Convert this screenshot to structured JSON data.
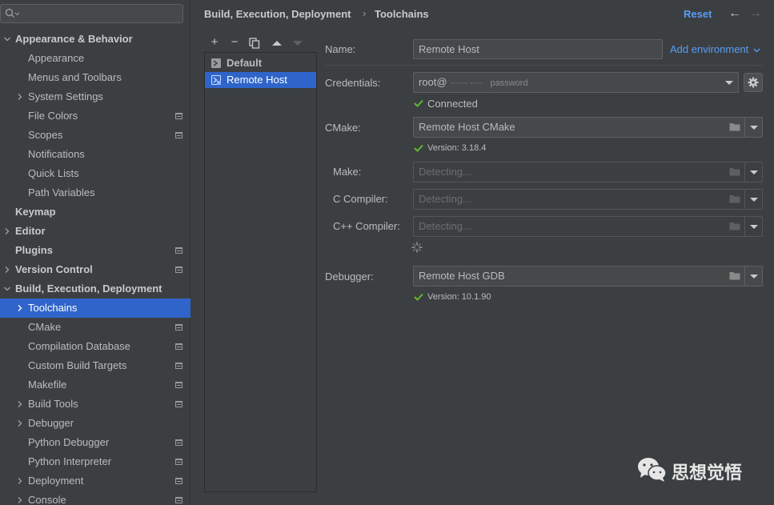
{
  "sidebar": {
    "search": {
      "placeholder": ""
    },
    "items": [
      {
        "label": "Appearance & Behavior",
        "indent": 0,
        "expanded": true,
        "bold": true
      },
      {
        "label": "Appearance",
        "indent": 1
      },
      {
        "label": "Menus and Toolbars",
        "indent": 1
      },
      {
        "label": "System Settings",
        "indent": 1,
        "collapsed": true
      },
      {
        "label": "File Colors",
        "indent": 1,
        "project": true
      },
      {
        "label": "Scopes",
        "indent": 1,
        "project": true
      },
      {
        "label": "Notifications",
        "indent": 1
      },
      {
        "label": "Quick Lists",
        "indent": 1
      },
      {
        "label": "Path Variables",
        "indent": 1
      },
      {
        "label": "Keymap",
        "indent": 0,
        "bold": true
      },
      {
        "label": "Editor",
        "indent": 0,
        "bold": true,
        "collapsed": true
      },
      {
        "label": "Plugins",
        "indent": 0,
        "bold": true,
        "project": true
      },
      {
        "label": "Version Control",
        "indent": 0,
        "bold": true,
        "collapsed": true,
        "project": true
      },
      {
        "label": "Build, Execution, Deployment",
        "indent": 0,
        "bold": true,
        "expanded": true
      },
      {
        "label": "Toolchains",
        "indent": 1,
        "collapsed": true,
        "selected": true
      },
      {
        "label": "CMake",
        "indent": 1,
        "project": true
      },
      {
        "label": "Compilation Database",
        "indent": 1,
        "project": true
      },
      {
        "label": "Custom Build Targets",
        "indent": 1,
        "project": true
      },
      {
        "label": "Makefile",
        "indent": 1,
        "project": true
      },
      {
        "label": "Build Tools",
        "indent": 1,
        "collapsed": true,
        "project": true
      },
      {
        "label": "Debugger",
        "indent": 1,
        "collapsed": true
      },
      {
        "label": "Python Debugger",
        "indent": 1,
        "project": true
      },
      {
        "label": "Python Interpreter",
        "indent": 1,
        "project": true
      },
      {
        "label": "Deployment",
        "indent": 1,
        "collapsed": true,
        "project": true
      },
      {
        "label": "Console",
        "indent": 1,
        "collapsed": true,
        "project": true
      }
    ]
  },
  "header": {
    "breadcrumb": [
      "Build, Execution, Deployment",
      "Toolchains"
    ],
    "breadcrumb_separator": "›",
    "reset_label": "Reset",
    "back_arrow": "←",
    "forward_arrow": "→"
  },
  "toolchains": {
    "toolbar": {
      "add": "+",
      "remove": "−",
      "copy": "copy-icon",
      "up": "up-icon",
      "down": "down-icon"
    },
    "items": [
      {
        "label": "Default",
        "selected": false
      },
      {
        "label": "Remote Host",
        "selected": true
      }
    ]
  },
  "form": {
    "name": {
      "label": "Name:",
      "value": "Remote Host"
    },
    "add_environment": "Add environment",
    "credentials": {
      "label": "Credentials:",
      "value": "root@",
      "masked": "······· ·····",
      "hint": "password"
    },
    "connection_status": "Connected",
    "cmake": {
      "label": "CMake:",
      "value": "Remote Host CMake",
      "version": "Version: 3.18.4"
    },
    "make": {
      "label": "Make:",
      "value": "Detecting..."
    },
    "c_compiler": {
      "label": "C Compiler:",
      "value": "Detecting..."
    },
    "cpp_compiler": {
      "label": "C++ Compiler:",
      "value": "Detecting..."
    },
    "debugger": {
      "label": "Debugger:",
      "value": "Remote Host GDB",
      "version": "Version: 10.1.90"
    }
  },
  "watermark": {
    "text": "思想觉悟"
  },
  "colors": {
    "accent": "#589df6",
    "selection": "#2f65ca",
    "success": "#5fb832",
    "background": "#3c3f41"
  }
}
